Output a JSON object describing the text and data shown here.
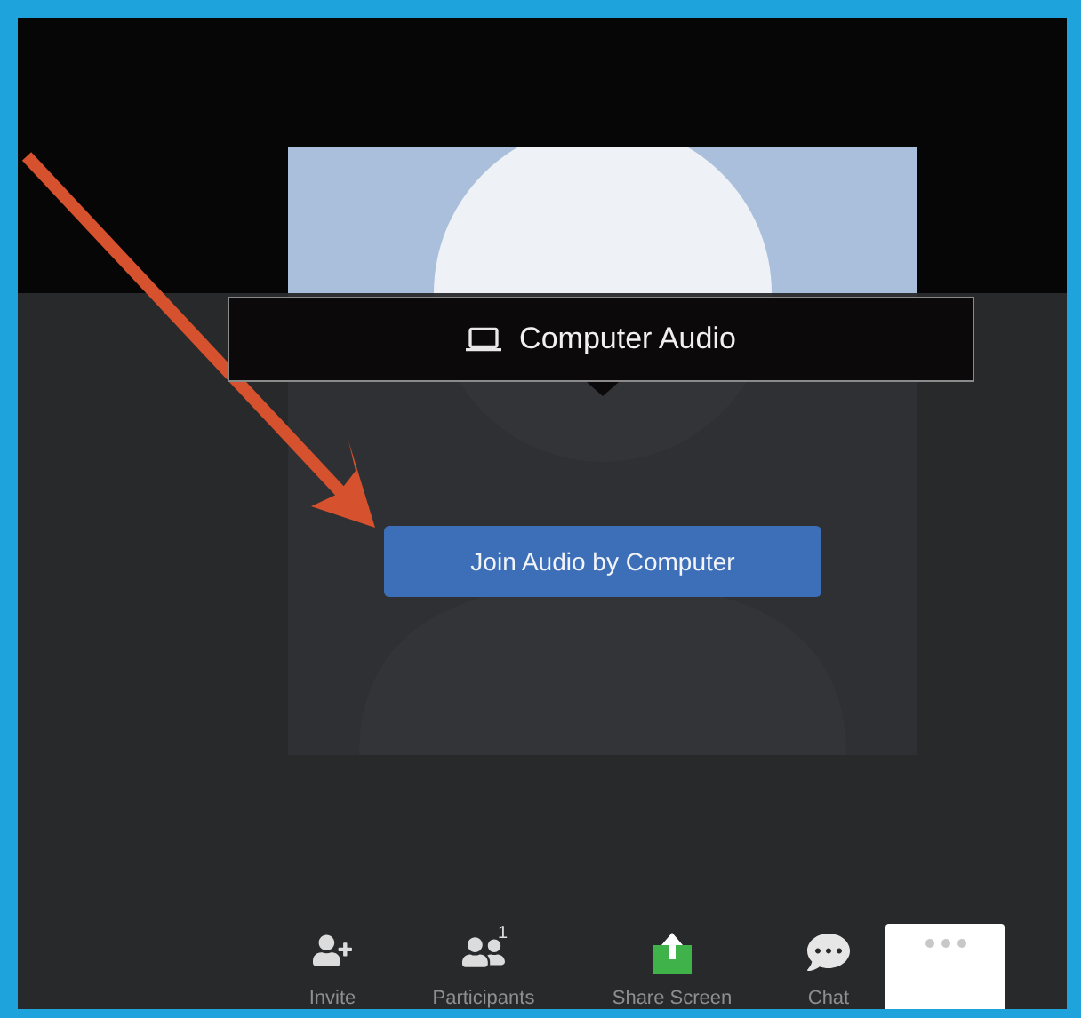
{
  "audio_tab": {
    "label": "Computer Audio"
  },
  "join_button": {
    "label": "Join Audio by Computer"
  },
  "toolbar": [
    {
      "kind": "invite",
      "label": "Invite"
    },
    {
      "kind": "participants",
      "label": "Participants",
      "badge": "1"
    },
    {
      "kind": "share",
      "label": "Share Screen"
    },
    {
      "kind": "chat",
      "label": "Chat"
    },
    {
      "kind": "more"
    }
  ]
}
